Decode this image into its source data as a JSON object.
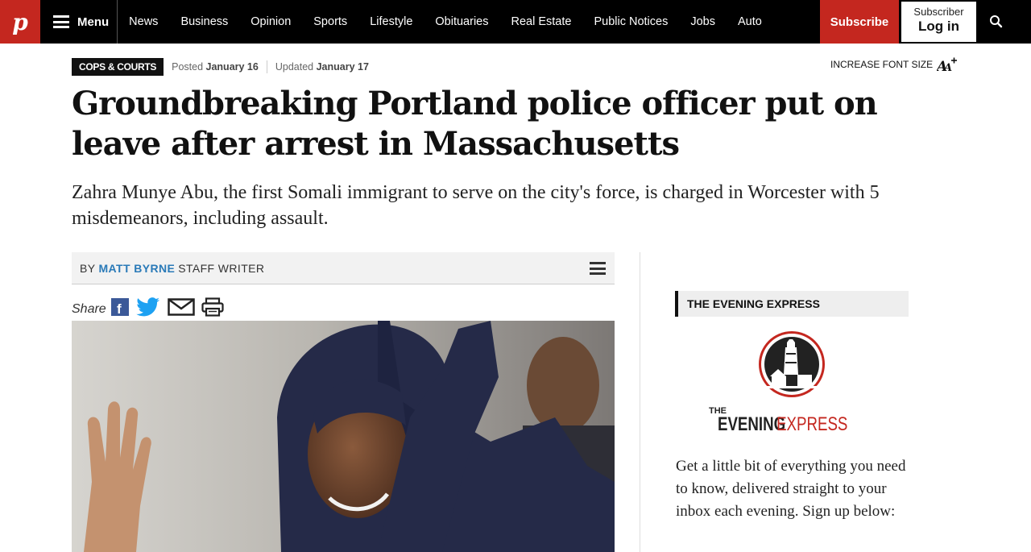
{
  "nav": {
    "logo_letter": "p",
    "menu_label": "Menu",
    "items": [
      {
        "label": "News"
      },
      {
        "label": "Business"
      },
      {
        "label": "Opinion"
      },
      {
        "label": "Sports"
      },
      {
        "label": "Lifestyle"
      },
      {
        "label": "Obituaries"
      },
      {
        "label": "Real Estate"
      },
      {
        "label": "Public Notices"
      },
      {
        "label": "Jobs"
      },
      {
        "label": "Auto"
      }
    ],
    "subscribe_label": "Subscribe",
    "subscriber_label": "Subscriber",
    "login_label": "Log in",
    "search_icon": "search-icon"
  },
  "article": {
    "category": "COPS & COURTS",
    "posted_label": "Posted",
    "posted_date": "January 16",
    "updated_label": "Updated",
    "updated_date": "January 17",
    "font_size_label": "INCREASE FONT SIZE",
    "headline": "Groundbreaking Portland police officer put on leave after arrest in Massachusetts",
    "dek": "Zahra Munye Abu, the first Somali immigrant to serve on the city's force, is charged in Worcester with 5 misdemeanors, including assault.",
    "byline_prefix": "BY",
    "author": "MATT BYRNE",
    "author_role": "STAFF WRITER",
    "share_label": "Share",
    "share_icons": [
      "facebook-icon",
      "twitter-icon",
      "email-icon",
      "print-icon"
    ]
  },
  "sidebar": {
    "heading": "THE EVENING EXPRESS",
    "logo_the": "THE",
    "logo_evening": "EVENING",
    "logo_express": "EXPRESS",
    "text": "Get a little bit of everything you need to know, delivered straight to your inbox each evening. Sign up below:"
  },
  "colors": {
    "brand_red": "#c4271f",
    "nav_bg": "#000000",
    "link_blue": "#2a7ab8",
    "facebook": "#3b5998",
    "twitter": "#1da1f2"
  }
}
